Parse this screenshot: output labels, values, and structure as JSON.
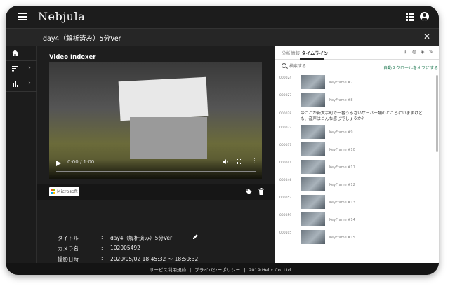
{
  "app": {
    "logo": "Nebjula"
  },
  "subbar": {
    "title": "day4（解析済み）5分Ver",
    "close": "✕"
  },
  "player": {
    "section_title": "Video Indexer",
    "time": "0:00 / 1:00",
    "progress": 0
  },
  "brand": {
    "microsoft_label": "Microsoft"
  },
  "meta": [
    {
      "label": "タイトル",
      "value": "day4（解析済み）5分Ver"
    },
    {
      "label": "カメラ名",
      "value": "102005492"
    },
    {
      "label": "撮影日時",
      "value": "2020/05/02 18:45:32 ～ 18:50:32"
    }
  ],
  "meta_colon": ":",
  "right": {
    "tabs": [
      {
        "label": "分析情報"
      },
      {
        "label": "タイムライン"
      }
    ],
    "search_placeholder": "検索する",
    "autoscroll_label": "自動スクロールをオフにする",
    "timeline": [
      {
        "time": "000024",
        "label": "KeyFrame #7",
        "kind": "frame"
      },
      {
        "time": "000027",
        "label": "KeyFrame #8",
        "kind": "frame"
      },
      {
        "time": "000028",
        "text": "今ここが新大手町で一番うるさいサーバー類のところにいますけども、音声はこんな感じでしょうか？",
        "kind": "text"
      },
      {
        "time": "000032",
        "label": "KeyFrame #9",
        "kind": "frame"
      },
      {
        "time": "000037",
        "label": "KeyFrame #10",
        "kind": "frame"
      },
      {
        "time": "000041",
        "label": "KeyFrame #11",
        "kind": "frame"
      },
      {
        "time": "000046",
        "label": "KeyFrame #12",
        "kind": "frame"
      },
      {
        "time": "000052",
        "label": "KeyFrame #13",
        "kind": "frame"
      },
      {
        "time": "000059",
        "label": "KeyFrame #14",
        "kind": "frame"
      },
      {
        "time": "000105",
        "label": "KeyFrame #15",
        "kind": "frame"
      }
    ]
  },
  "footer": {
    "terms": "サービス利用規約",
    "privacy": "プライバシーポリシー",
    "copyright": "2019 Helix Co. Ltd.",
    "sep": "|"
  },
  "colors": {
    "accent": "#2a7f5a",
    "background": "#1c1c1c"
  }
}
